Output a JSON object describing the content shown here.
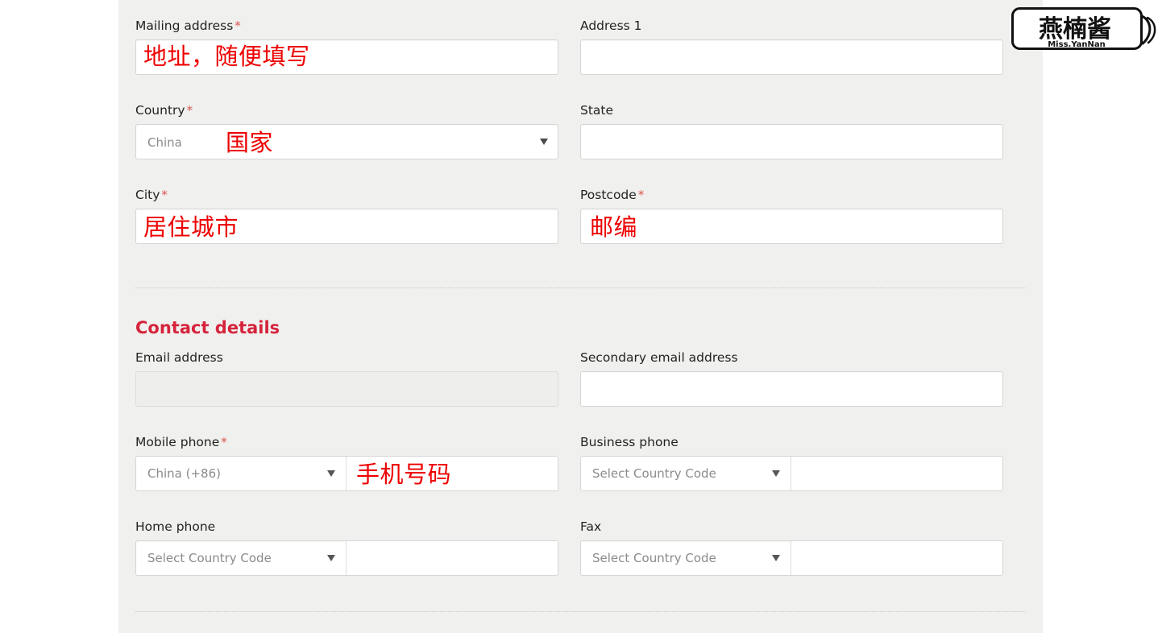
{
  "page": {
    "background_color": "#ffffff",
    "panel_color": "#f0f0ee",
    "accent_color": "#d5243c",
    "annotation_color": "#ee0000",
    "required_marker": "*"
  },
  "address_section": {
    "fields": {
      "mailing_address": {
        "label": "Mailing address",
        "required": true,
        "value": "",
        "placeholder": ""
      },
      "address_1": {
        "label": "Address 1",
        "required": false,
        "value": "",
        "placeholder": ""
      },
      "country": {
        "label": "Country",
        "required": true,
        "selected": "China",
        "caret": "chevron-down-icon"
      },
      "state": {
        "label": "State",
        "required": false,
        "value": "",
        "placeholder": ""
      },
      "city": {
        "label": "City",
        "required": true,
        "value": "",
        "placeholder": ""
      },
      "postcode": {
        "label": "Postcode",
        "required": true,
        "value": "",
        "placeholder": ""
      }
    }
  },
  "contact_section": {
    "heading": "Contact details",
    "fields": {
      "email_address": {
        "label": "Email address",
        "required": false,
        "value": "",
        "placeholder": "",
        "disabled": true
      },
      "secondary_email_address": {
        "label": "Secondary email address",
        "required": false,
        "value": "",
        "placeholder": ""
      },
      "mobile_phone": {
        "label": "Mobile phone",
        "required": true,
        "country_code": "China (+86)",
        "number": ""
      },
      "business_phone": {
        "label": "Business phone",
        "required": false,
        "country_code": "Select Country Code",
        "number": ""
      },
      "home_phone": {
        "label": "Home phone",
        "required": false,
        "country_code": "Select Country Code",
        "number": ""
      },
      "fax": {
        "label": "Fax",
        "required": false,
        "country_code": "Select Country Code",
        "number": ""
      }
    }
  },
  "annotations": {
    "mailing_address": "地址，随便填写",
    "country": "国家",
    "city": "居住城市",
    "postcode": "邮编",
    "mobile_phone": "手机号码"
  },
  "watermark": {
    "logo_text": "燕楠酱",
    "sub_text": "Miss.YanNan"
  }
}
